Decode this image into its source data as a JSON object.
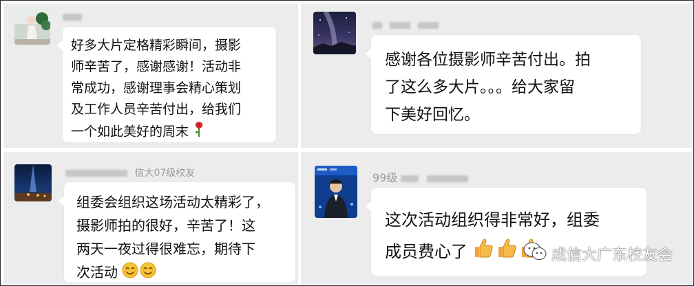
{
  "messages": [
    {
      "name_text": "",
      "lines": [
        "好多大片定格精彩瞬间，摄影",
        "师辛苦了，感谢感谢！活动非",
        "常成功，感谢理事会精心策划",
        "及工作人员辛苦付出，给我们",
        "一个如此美好的周末"
      ],
      "emoji": "rose-icon"
    },
    {
      "name_text": "",
      "lines": [
        "感谢各位摄影师辛苦付出。拍",
        "了这么多大片。。。给大家留",
        "下美好回忆。"
      ]
    },
    {
      "name_text": "信大07级校友",
      "lines": [
        "组委会组织这场活动太精彩了，",
        "摄影师拍的很好，辛苦了！这",
        "两天一夜过得很难忘，期待下",
        "次活动"
      ],
      "emoji": "smile-icon"
    },
    {
      "name_text": "99级",
      "lines": [
        "这次活动组织得非常好，组委",
        "成员费心了"
      ],
      "emoji": "thumbs-up-icon"
    }
  ],
  "watermark": {
    "text": "成信大广东校友会",
    "icon": "wechat-icon"
  },
  "colors": {
    "panel_bg": "#ececec",
    "bubble_bg": "#ffffff",
    "name_text": "#9a9a9a"
  }
}
